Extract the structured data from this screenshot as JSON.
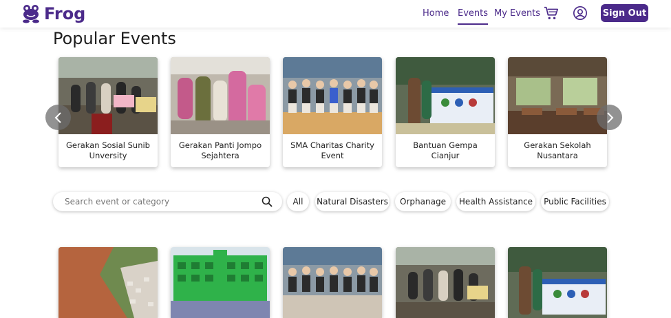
{
  "brand": {
    "name": "Frog",
    "color": "#4b2a8a"
  },
  "nav": {
    "home": "Home",
    "events": "Events",
    "my_events": "My Events",
    "cart_icon": "cart-icon",
    "profile_icon": "user-circle-icon",
    "sign_out": "Sign Out"
  },
  "popular": {
    "title": "Popular Events",
    "cards": [
      {
        "caption": "Gerakan Sosial Sunib Unversity"
      },
      {
        "caption": "Gerakan Panti Jompo Sejahtera"
      },
      {
        "caption": "SMA Charitas Charity Event"
      },
      {
        "caption": "Bantuan Gempa Cianjur"
      },
      {
        "caption": "Gerakan Sekolah Nusantara"
      }
    ]
  },
  "search": {
    "placeholder": "Search event or category"
  },
  "categories": [
    "All",
    "Natural Disasters",
    "Orphanage",
    "Health Assistance",
    "Public Facilities"
  ]
}
